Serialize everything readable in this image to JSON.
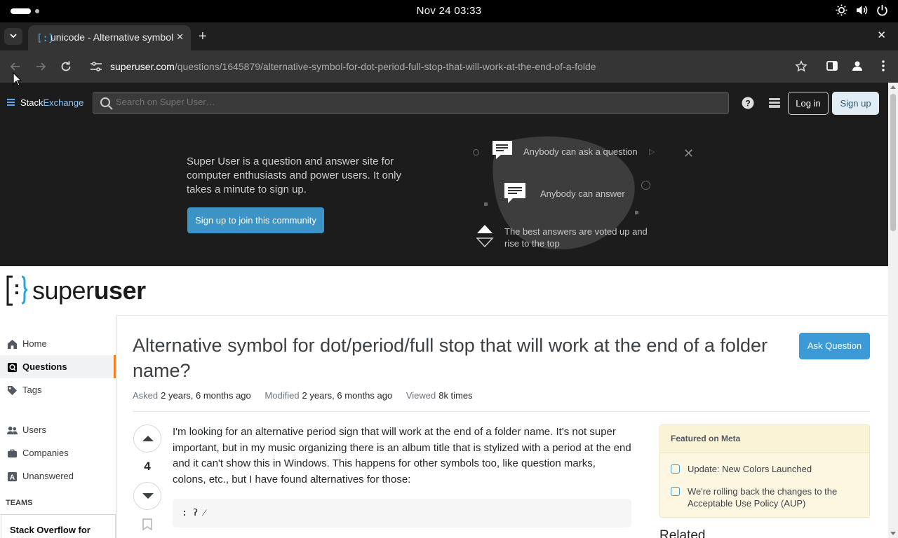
{
  "os": {
    "clock": "Nov 24  03:33",
    "icons": [
      "brightness-icon",
      "volume-icon",
      "power-icon"
    ]
  },
  "browser": {
    "tab_title": "unicode - Alternative symbol for dot/period/full stop that will work at the end of a folder name? - Super User",
    "tab_favicon": "[:}",
    "url_host": "superuser.com",
    "url_path": "/questions/1645879/alternative-symbol-for-dot-period-full-stop-that-will-work-at-the-end-of-a-folde"
  },
  "se_header": {
    "logo_stack": "Stack",
    "logo_exchange": "Exchange",
    "search_placeholder": "Search on Super User…",
    "login_label": "Log in",
    "signup_label": "Sign up"
  },
  "hero": {
    "text": "Super User is a question and answer site for computer enthusiasts and power users. It only takes a minute to sign up.",
    "cta": "Sign up to join this community",
    "feature_ask": "Anybody can ask a question",
    "feature_answer": "Anybody can answer",
    "feature_vote": "The best answers are voted up and rise to the top"
  },
  "site_logo": {
    "part1": "super",
    "part2": "user"
  },
  "nav": {
    "items": [
      {
        "label": "Home",
        "icon": "home-icon"
      },
      {
        "label": "Questions",
        "icon": "questions-icon",
        "active": true
      },
      {
        "label": "Tags",
        "icon": "tag-icon"
      },
      {
        "label": "Users",
        "icon": "users-icon"
      },
      {
        "label": "Companies",
        "icon": "briefcase-icon"
      },
      {
        "label": "Unanswered",
        "icon": "unanswered-icon"
      }
    ],
    "teams_heading": "TEAMS",
    "teams_card": "Stack Overflow for"
  },
  "question": {
    "title": "Alternative symbol for dot/period/full stop that will work at the end of a folder name?",
    "ask_button": "Ask Question",
    "asked_label": "Asked",
    "asked_value": "2 years, 6 months ago",
    "modified_label": "Modified",
    "modified_value": "2 years, 6 months ago",
    "viewed_label": "Viewed",
    "viewed_value": "8k times",
    "votes": "4",
    "body": "I'm looking for an alternative period sign that will work at the end of a folder name. It's not super important, but in my music organizing there is an album title that is stylized with a period at the end and it can't show this in Windows. This happens for other symbols too, like question marks, colons, etc., but I have found alternatives for those:",
    "code": "꞉ ʔ ⁄"
  },
  "featured": {
    "heading": "Featured on Meta",
    "items": [
      "Update: New Colors Launched",
      "We're rolling back the changes to the Acceptable Use Policy (AUP)"
    ],
    "related_heading": "Related"
  }
}
